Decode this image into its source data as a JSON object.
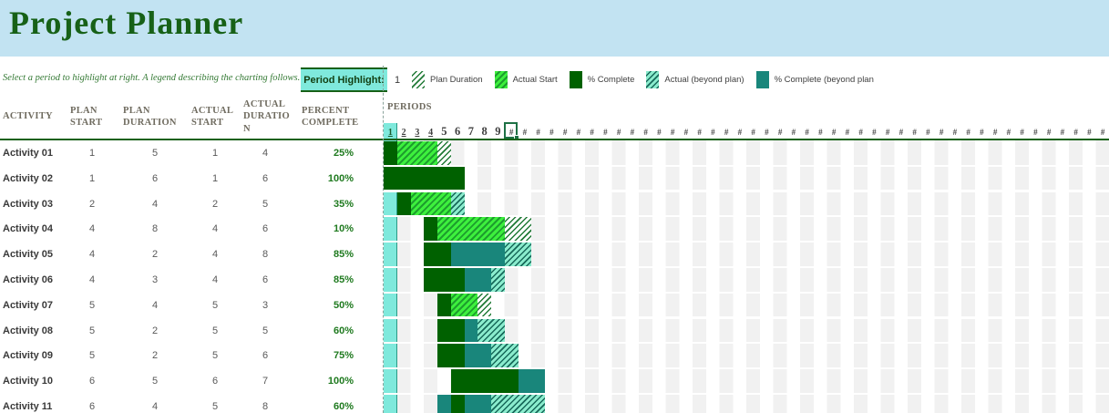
{
  "title": "Project Planner",
  "subtitle": "Select a period to highlight at right.  A legend describing the charting follows.",
  "period_highlight": {
    "label": "Period Highlight:",
    "value": "1"
  },
  "legend": [
    {
      "label": "Plan Duration",
      "swatch": "plan"
    },
    {
      "label": "Actual Start",
      "swatch": "actual"
    },
    {
      "label": "% Complete",
      "swatch": "complete"
    },
    {
      "label": "Actual (beyond plan)",
      "swatch": "beyond_actual"
    },
    {
      "label": "% Complete (beyond plan",
      "swatch": "beyond_complete"
    }
  ],
  "table": {
    "headers": [
      "ACTIVITY",
      "PLAN START",
      "PLAN DURATION",
      "ACTUAL START",
      "ACTUAL DURATION",
      "PERCENT COMPLETE"
    ],
    "rows": [
      {
        "activity": "Activity 01",
        "plan_start": 1,
        "plan_duration": 5,
        "actual_start": 1,
        "actual_duration": 4,
        "percent_complete": "25%"
      },
      {
        "activity": "Activity 02",
        "plan_start": 1,
        "plan_duration": 6,
        "actual_start": 1,
        "actual_duration": 6,
        "percent_complete": "100%"
      },
      {
        "activity": "Activity 03",
        "plan_start": 2,
        "plan_duration": 4,
        "actual_start": 2,
        "actual_duration": 5,
        "percent_complete": "35%"
      },
      {
        "activity": "Activity 04",
        "plan_start": 4,
        "plan_duration": 8,
        "actual_start": 4,
        "actual_duration": 6,
        "percent_complete": "10%"
      },
      {
        "activity": "Activity 05",
        "plan_start": 4,
        "plan_duration": 2,
        "actual_start": 4,
        "actual_duration": 8,
        "percent_complete": "85%"
      },
      {
        "activity": "Activity 06",
        "plan_start": 4,
        "plan_duration": 3,
        "actual_start": 4,
        "actual_duration": 6,
        "percent_complete": "85%"
      },
      {
        "activity": "Activity 07",
        "plan_start": 5,
        "plan_duration": 4,
        "actual_start": 5,
        "actual_duration": 3,
        "percent_complete": "50%"
      },
      {
        "activity": "Activity 08",
        "plan_start": 5,
        "plan_duration": 2,
        "actual_start": 5,
        "actual_duration": 5,
        "percent_complete": "60%"
      },
      {
        "activity": "Activity 09",
        "plan_start": 5,
        "plan_duration": 2,
        "actual_start": 5,
        "actual_duration": 6,
        "percent_complete": "75%"
      },
      {
        "activity": "Activity 10",
        "plan_start": 6,
        "plan_duration": 5,
        "actual_start": 6,
        "actual_duration": 7,
        "percent_complete": "100%"
      },
      {
        "activity": "Activity 11",
        "plan_start": 6,
        "plan_duration": 4,
        "actual_start": 5,
        "actual_duration": 8,
        "percent_complete": "60%"
      }
    ]
  },
  "chart": {
    "periods_label": "PERIODS",
    "visible_periods": 54,
    "numbered_periods": 9,
    "overflow_glyph": "#",
    "highlight_period": 1,
    "selected_period": 10,
    "bars": [
      {
        "row": 1,
        "segments": [
          {
            "start": 1,
            "len": 1,
            "type": "complete"
          },
          {
            "start": 2,
            "len": 3,
            "type": "actual"
          },
          {
            "start": 5,
            "len": 1,
            "type": "plan"
          }
        ]
      },
      {
        "row": 2,
        "segments": [
          {
            "start": 1,
            "len": 6,
            "type": "complete"
          }
        ]
      },
      {
        "row": 3,
        "segments": [
          {
            "start": 2,
            "len": 1,
            "type": "complete"
          },
          {
            "start": 3,
            "len": 3,
            "type": "actual"
          },
          {
            "start": 6,
            "len": 1,
            "type": "beyond_actual"
          }
        ]
      },
      {
        "row": 4,
        "segments": [
          {
            "start": 4,
            "len": 1,
            "type": "complete"
          },
          {
            "start": 5,
            "len": 5,
            "type": "actual"
          },
          {
            "start": 10,
            "len": 2,
            "type": "plan"
          }
        ]
      },
      {
        "row": 5,
        "segments": [
          {
            "start": 4,
            "len": 2,
            "type": "complete"
          },
          {
            "start": 6,
            "len": 4,
            "type": "beyond_complete"
          },
          {
            "start": 10,
            "len": 2,
            "type": "beyond_actual"
          }
        ]
      },
      {
        "row": 6,
        "segments": [
          {
            "start": 4,
            "len": 3,
            "type": "complete"
          },
          {
            "start": 7,
            "len": 2,
            "type": "beyond_complete"
          },
          {
            "start": 9,
            "len": 1,
            "type": "beyond_actual"
          }
        ]
      },
      {
        "row": 7,
        "segments": [
          {
            "start": 5,
            "len": 1,
            "type": "complete"
          },
          {
            "start": 6,
            "len": 2,
            "type": "actual"
          },
          {
            "start": 8,
            "len": 1,
            "type": "plan"
          }
        ]
      },
      {
        "row": 8,
        "segments": [
          {
            "start": 5,
            "len": 2,
            "type": "complete"
          },
          {
            "start": 7,
            "len": 1,
            "type": "beyond_complete"
          },
          {
            "start": 8,
            "len": 2,
            "type": "beyond_actual"
          }
        ]
      },
      {
        "row": 9,
        "segments": [
          {
            "start": 5,
            "len": 2,
            "type": "complete"
          },
          {
            "start": 7,
            "len": 2,
            "type": "beyond_complete"
          },
          {
            "start": 9,
            "len": 2,
            "type": "beyond_actual"
          }
        ]
      },
      {
        "row": 10,
        "segments": [
          {
            "start": 6,
            "len": 5,
            "type": "complete"
          },
          {
            "start": 11,
            "len": 2,
            "type": "beyond_complete"
          }
        ]
      },
      {
        "row": 11,
        "segments": [
          {
            "start": 5,
            "len": 1,
            "type": "beyond_complete"
          },
          {
            "start": 6,
            "len": 1,
            "type": "complete"
          },
          {
            "start": 7,
            "len": 2,
            "type": "beyond_complete"
          },
          {
            "start": 9,
            "len": 4,
            "type": "beyond_actual"
          }
        ]
      }
    ]
  },
  "colors": {
    "band_blue": "#c2e3f2",
    "title_green": "#176117",
    "complete_dark_green": "#006100",
    "actual_bright_green": "#3df03d",
    "beyond_complete_teal": "#19867b",
    "beyond_actual_mint": "#8aeccd",
    "highlight_cyan": "#7fe9dc",
    "stripe_gray": "#f1f1f1",
    "selection_green": "#1e7145",
    "percent_text_green": "#1f7a1f"
  }
}
